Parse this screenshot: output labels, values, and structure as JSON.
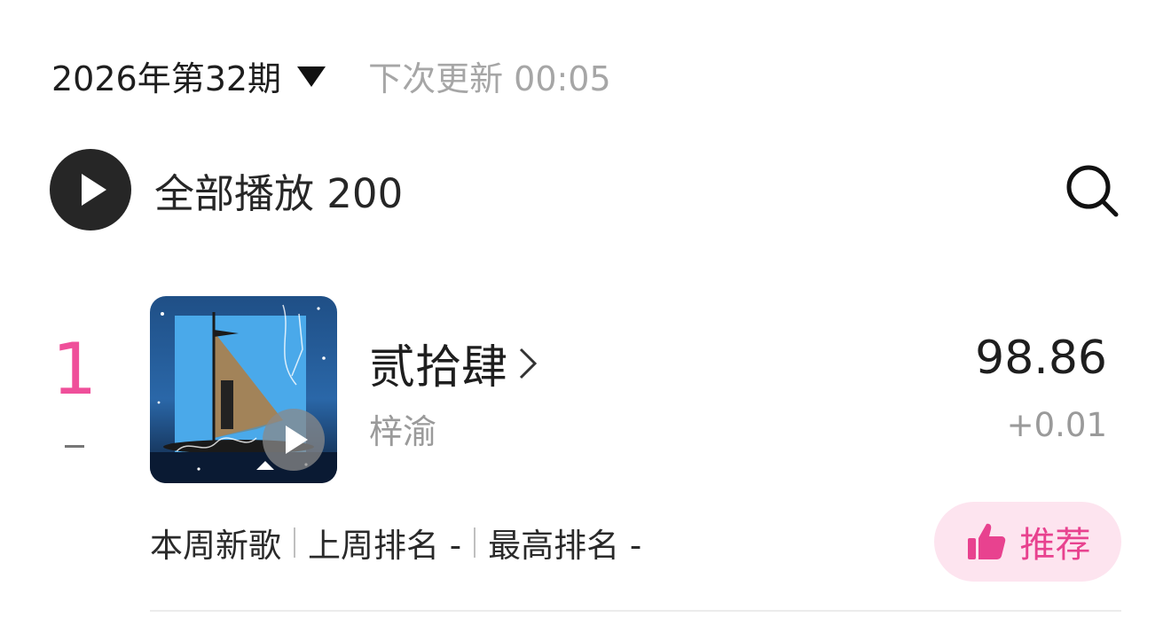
{
  "header": {
    "period_label": "2026年第32期",
    "next_update": "下次更新 00:05"
  },
  "play_all": {
    "label": "全部播放 200"
  },
  "songs": [
    {
      "rank": "1",
      "rank_change": "",
      "title": "贰拾肆",
      "artist": "梓渝",
      "score": "98.86",
      "score_change": "+0.01",
      "cover_icon": "album-art-sailboat-night",
      "tags": [
        "本周新歌",
        "上周排名 -",
        "最高排名 -"
      ],
      "recommend_label": "推荐"
    }
  ],
  "colors": {
    "rank_accent": "#ef4f9a",
    "recommend_bg": "#fde4ef",
    "recommend_text": "#e8428f",
    "play_button": "#262626",
    "secondary_text": "#9a9a9a"
  },
  "icons": {
    "play_all": "play-circle-icon",
    "search": "search-icon",
    "dropdown": "triangle-down-icon",
    "chevron": "chevron-right-icon",
    "recommend": "thumbs-up-icon"
  }
}
